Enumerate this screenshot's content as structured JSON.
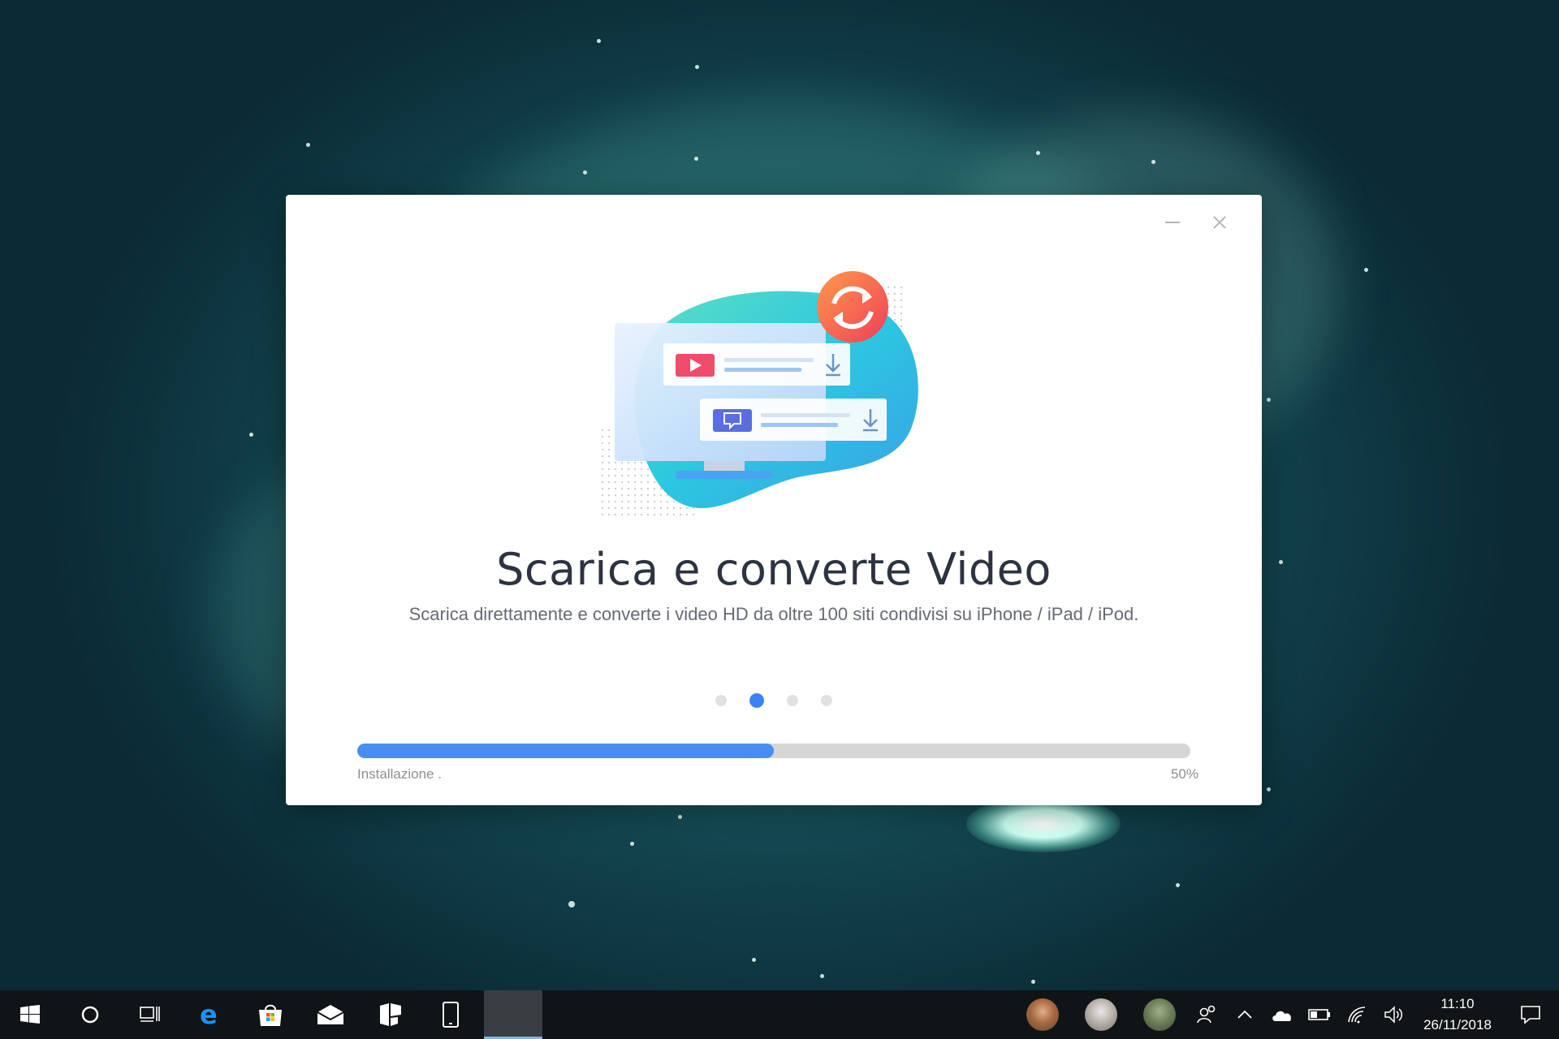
{
  "installer": {
    "title": "Scarica e converte Video",
    "subtitle": "Scarica direttamente e converte i video HD da oltre 100 siti condivisi su iPhone / iPad / iPod.",
    "slides": {
      "count": 4,
      "active_index": 1
    },
    "progress": {
      "status_label": "Installazione .",
      "percent_label": "50%",
      "fraction": 0.5
    },
    "window_controls": [
      "minimize-icon",
      "close-icon"
    ]
  },
  "taskbar": {
    "apps": [
      "windows-start-icon",
      "cortana-search-icon",
      "task-view-icon",
      "edge-browser-icon",
      "microsoft-store-icon",
      "mail-icon",
      "flipboard-icon",
      "phone-icon",
      "installer-app-icon"
    ],
    "people": [
      "contact-avatar-1",
      "contact-avatar-2",
      "contact-avatar-3"
    ],
    "tray": [
      "people-icon",
      "chevron-up-icon",
      "onedrive-cloud-icon",
      "battery-icon",
      "wifi-icon",
      "volume-icon"
    ],
    "time": "11:10",
    "date": "26/11/2018",
    "notification_icon": "action-center-icon"
  },
  "colors": {
    "accent": "#4a8df0",
    "title": "#2d3340",
    "taskbar": "#101417"
  }
}
